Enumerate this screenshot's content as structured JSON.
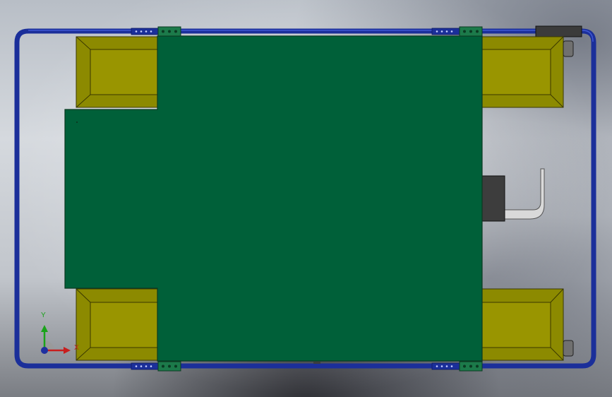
{
  "scene": {
    "view": "top",
    "colors": {
      "frame_tube": "#1b2f9a",
      "frame_tube_highlight": "#3f58d4",
      "pcb": "#006039",
      "pcb_edge": "#0b3a22",
      "wheel_body": "#8c8a00",
      "wheel_inner": "#999500",
      "wheel_edge": "#3a3800",
      "connector": "#1c7a4a",
      "bracket_dark": "#3d3d3d",
      "pipe": "#d9d9d9"
    },
    "components": {
      "frame": "tube-frame",
      "board": "main-pcb",
      "wheels": [
        "wheel-front-left",
        "wheel-front-right",
        "wheel-rear-left",
        "wheel-rear-right"
      ],
      "connectors": [
        "header-top-left",
        "header-top-right",
        "header-bottom-left",
        "header-bottom-right"
      ],
      "bracket": "side-bracket"
    }
  },
  "triad": {
    "y_label": "Y",
    "x_label": "X",
    "y_color": "#1aa31a",
    "x_color": "#c81e1e",
    "z_color": "#1f2fa0"
  }
}
